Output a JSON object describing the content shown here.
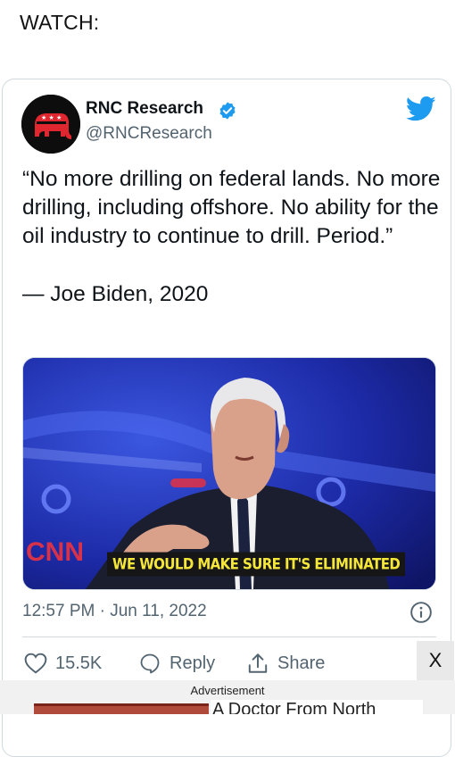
{
  "page": {
    "heading": "WATCH:"
  },
  "tweet": {
    "author_name": "RNC Research",
    "handle": "@RNCResearch",
    "quote": "“No more drilling on federal lands. No more drilling, including offshore. No ability for the oil industry to continue to drill. Period.”",
    "attribution": "— Joe Biden, 2020",
    "media": {
      "caption": "WE WOULD MAKE SURE IT'S ELIMINATED",
      "network_logo": "CNN"
    },
    "timestamp": "12:57 PM · Jun 11, 2022",
    "actions": {
      "like_count": "15.5K",
      "reply_label": "Reply",
      "share_label": "Share"
    }
  },
  "ad": {
    "label": "Advertisement",
    "close_label": "X",
    "headline_partial": "A Doctor From North"
  },
  "icons": {
    "avatar": "rnc-elephant-logo",
    "verified": "verified-badge-icon",
    "brand": "twitter-bird-icon",
    "info": "info-icon",
    "like": "heart-icon",
    "reply": "reply-bubble-icon",
    "share": "share-icon"
  },
  "colors": {
    "verified_blue": "#1d9bf0",
    "twitter_blue": "#1d9bf0",
    "rnc_red": "#e0262e",
    "caption_yellow": "#f5e63a",
    "secondary_text": "#536471"
  }
}
